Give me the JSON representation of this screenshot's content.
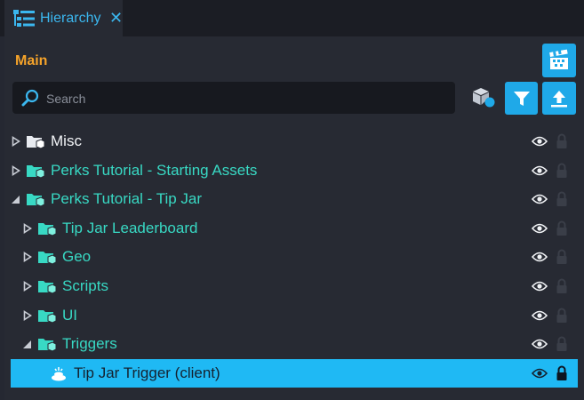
{
  "tab": {
    "title": "Hierarchy",
    "close": "✕"
  },
  "scope": {
    "label": "Main"
  },
  "search": {
    "placeholder": "Search",
    "value": ""
  },
  "colors": {
    "accent": "#1fa9e8",
    "orange": "#f5a32a",
    "teal": "#38d9c4",
    "selected": "#1fb9f4"
  },
  "tree": [
    {
      "label": "Misc",
      "depth": 0,
      "expanded": false,
      "color": "white",
      "type": "folder"
    },
    {
      "label": "Perks Tutorial - Starting Assets",
      "depth": 0,
      "expanded": false,
      "color": "teal",
      "type": "folder"
    },
    {
      "label": "Perks Tutorial - Tip Jar",
      "depth": 0,
      "expanded": true,
      "color": "teal",
      "type": "folder"
    },
    {
      "label": "Tip Jar Leaderboard",
      "depth": 1,
      "expanded": false,
      "color": "teal",
      "type": "folder"
    },
    {
      "label": "Geo",
      "depth": 1,
      "expanded": false,
      "color": "teal",
      "type": "folder"
    },
    {
      "label": "Scripts",
      "depth": 1,
      "expanded": false,
      "color": "teal",
      "type": "folder"
    },
    {
      "label": "UI",
      "depth": 1,
      "expanded": false,
      "color": "teal",
      "type": "folder"
    },
    {
      "label": "Triggers",
      "depth": 1,
      "expanded": true,
      "color": "teal",
      "type": "folder"
    },
    {
      "label": "Tip Jar Trigger (client)",
      "depth": 2,
      "expanded": null,
      "color": "dark",
      "type": "trigger",
      "selected": true
    }
  ]
}
